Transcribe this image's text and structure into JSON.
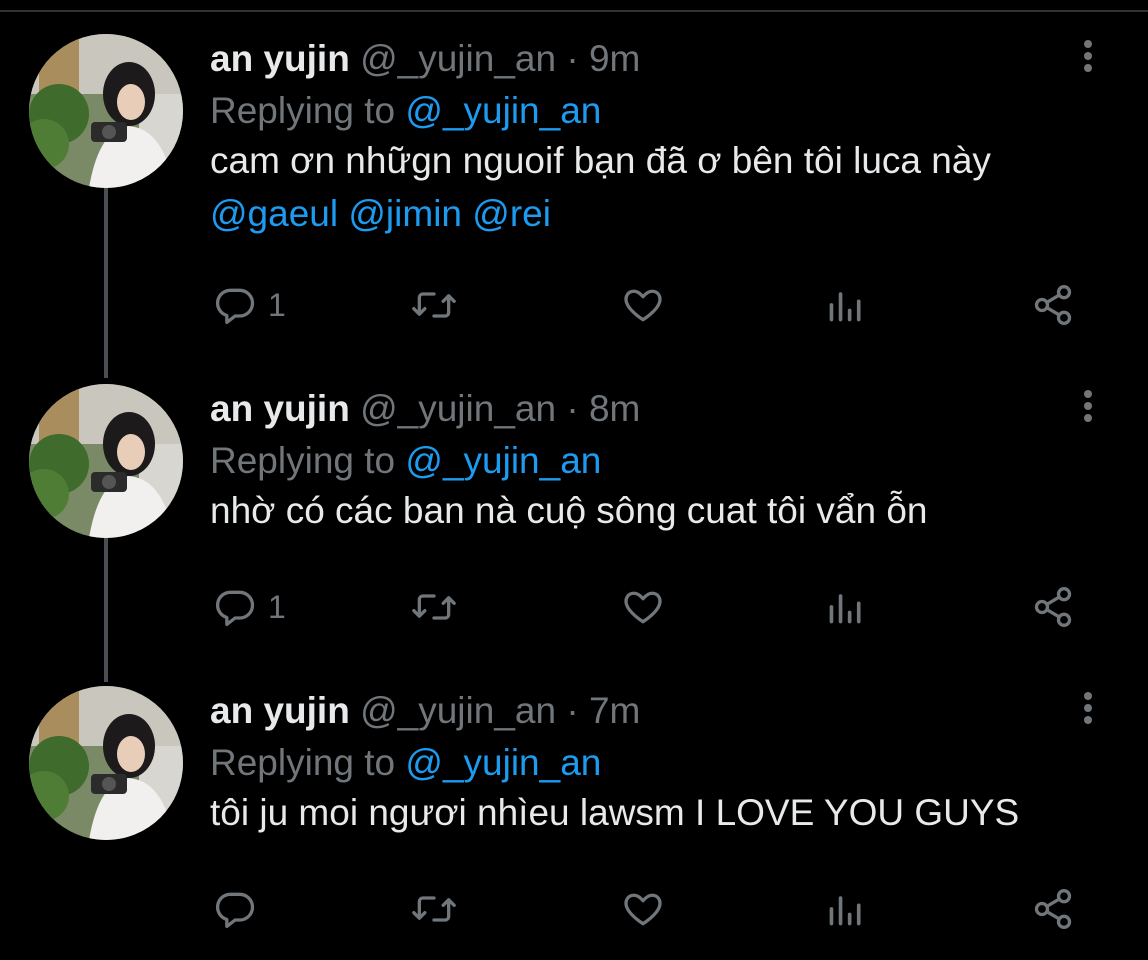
{
  "thread": [
    {
      "name": "an yujin",
      "handle": "@_yujin_an",
      "separator": "·",
      "time": "9m",
      "replying_label": "Replying to",
      "replying_to": "@_yujin_an",
      "text": "cam ơn nhữgn nguoif bạn đã ơ bên tôi luca này",
      "mentions": "@gaeul @jimin @rei",
      "reply_count": "1"
    },
    {
      "name": "an yujin",
      "handle": "@_yujin_an",
      "separator": "·",
      "time": "8m",
      "replying_label": "Replying to",
      "replying_to": "@_yujin_an",
      "text": "nhờ có các ban nà cuộ sông cuat tôi vẩn ỗn",
      "reply_count": "1"
    },
    {
      "name": "an yujin",
      "handle": "@_yujin_an",
      "separator": "·",
      "time": "7m",
      "replying_label": "Replying to",
      "replying_to": "@_yujin_an",
      "text": "tôi ju moi ngươi nhìeu lawsm I LOVE YOU GUYS",
      "reply_count": ""
    }
  ],
  "icons": {
    "reply": "reply-icon",
    "retweet": "retweet-icon",
    "like": "heart-icon",
    "analytics": "analytics-icon",
    "share": "share-icon",
    "more": "more-vertical-icon"
  },
  "colors": {
    "background": "#000000",
    "text": "#e7e9ea",
    "muted": "#71767b",
    "link": "#1d9bf0",
    "thread_line": "#4a4d52"
  }
}
